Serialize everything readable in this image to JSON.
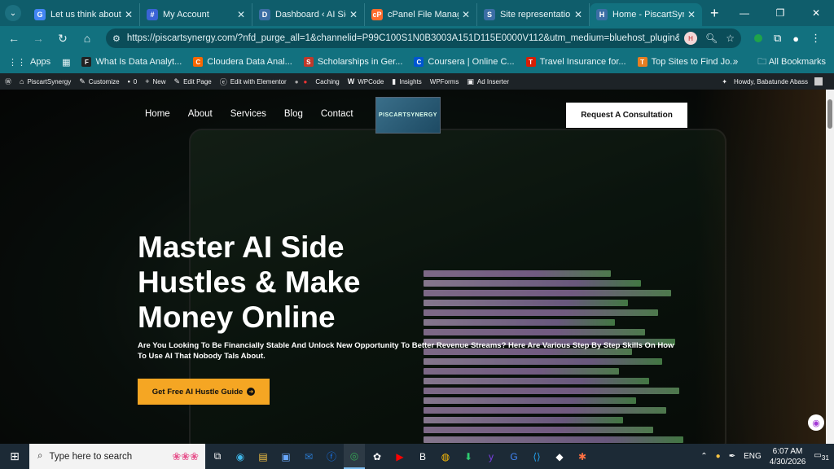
{
  "browser": {
    "tabs": [
      {
        "title": "Let us think about a t",
        "favicon": "G",
        "color": "#4285f4"
      },
      {
        "title": "My Account",
        "favicon": "#",
        "color": "#3a63d6"
      },
      {
        "title": "Dashboard ‹ AI Side H",
        "favicon": "D",
        "color": "#3b6ea5"
      },
      {
        "title": "cPanel File Manager v",
        "favicon": "cP",
        "color": "#ff6c2c"
      },
      {
        "title": "Site representation ‹",
        "favicon": "S",
        "color": "#3b6ea5"
      },
      {
        "title": "Home - PiscartSynergy",
        "favicon": "H",
        "color": "#3b6ea5"
      }
    ],
    "new_tab_label": "+",
    "url": "https://piscartsynergy.com/?nfd_purge_all=1&channelid=P99C100S1N0B3003A151D115E0000V112&utm_medium=bluehost_plugin&utm_sour..."
  },
  "bookmarks": {
    "apps_label": "Apps",
    "items": [
      {
        "label": "What Is Data Analyt...",
        "icon": "F",
        "color": "#222"
      },
      {
        "label": "Cloudera Data Anal...",
        "icon": "C",
        "color": "#f96702"
      },
      {
        "label": "Scholarships in Ger...",
        "icon": "S",
        "color": "#c0392b"
      },
      {
        "label": "Coursera | Online C...",
        "icon": "C",
        "color": "#0056d2"
      },
      {
        "label": "Travel Insurance for...",
        "icon": "T",
        "color": "#d81e05"
      },
      {
        "label": "Top Sites to Find Jo...",
        "icon": "T",
        "color": "#e67e22"
      }
    ],
    "more": "»",
    "all_bookmarks": "All Bookmarks"
  },
  "wp_admin": {
    "site": "PiscartSynergy",
    "customize": "Customize",
    "comments": "0",
    "new": "New",
    "edit_page": "Edit Page",
    "elementor": "Edit with Elementor",
    "caching": "Caching",
    "wpcode": "WPCode",
    "insights": "Insights",
    "wpforms": "WPForms",
    "ad_inserter": "Ad Inserter",
    "howdy": "Howdy, Babatunde Abass"
  },
  "site": {
    "nav": [
      "Home",
      "About",
      "Services",
      "Blog",
      "Contact"
    ],
    "logo_text": "PISCARTSYNERGY",
    "cta_top": "Request A Consultation",
    "heading": "Master AI Side Hustles & Make Money Online",
    "subheading": "Are You Looking To Be Financially Stable And Unlock New Opportunity To Better Revenue Streams? Here Are Various Step By Step Skills On How To Use AI That Nobody Tals About.",
    "cta_main": "Get Free AI Hustle Guide"
  },
  "taskbar": {
    "search_placeholder": "Type here to search",
    "lang": "ENG",
    "time": "6:07 AM",
    "date": "4/30/2026",
    "notifications": "31"
  }
}
